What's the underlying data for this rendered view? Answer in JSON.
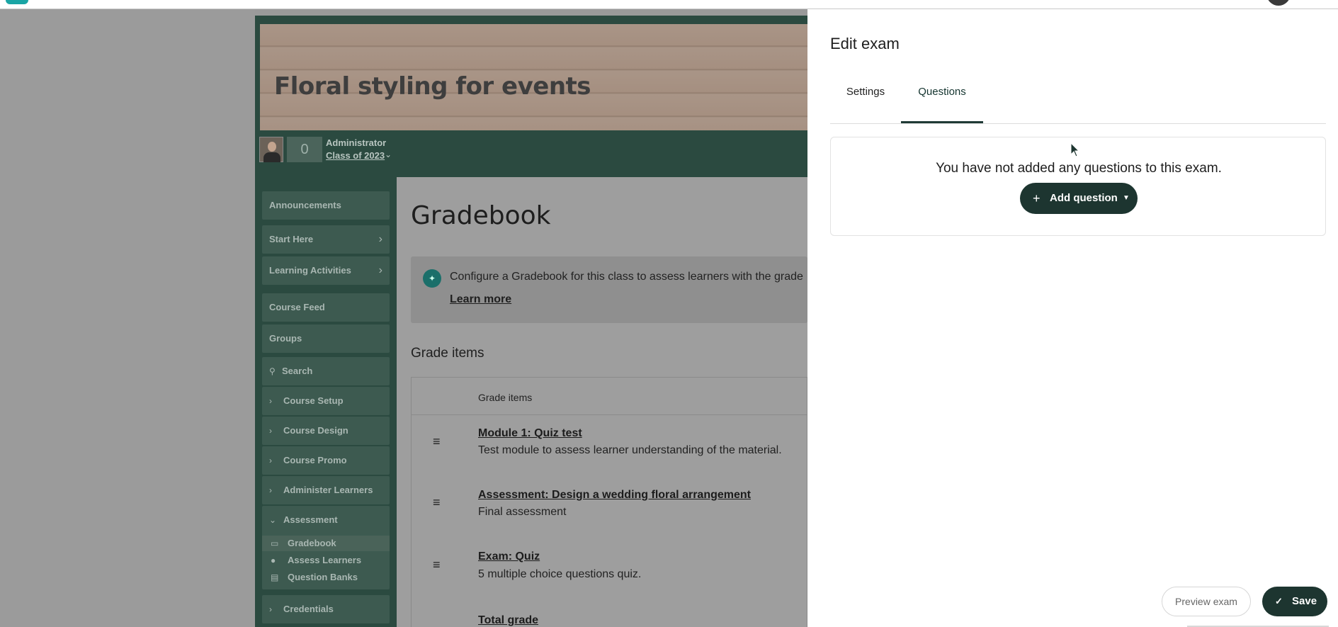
{
  "course": {
    "title": "Floral styling for events",
    "points": "0",
    "role": "Administrator",
    "class_label": "Class of 2023",
    "class_chevron": "⌄"
  },
  "sidebar": {
    "items": [
      {
        "label": "Announcements"
      },
      {
        "label": "Start Here",
        "arrow": "›"
      },
      {
        "label": "Learning Activities",
        "arrow": "›"
      },
      {
        "label": "Course Feed"
      },
      {
        "label": "Groups"
      },
      {
        "label": "Search",
        "icon": "search-icon"
      },
      {
        "label": "Course Setup"
      },
      {
        "label": "Course Design"
      },
      {
        "label": "Course Promo"
      },
      {
        "label": "Administer Learners"
      },
      {
        "label": "Assessment"
      },
      {
        "label": "Credentials"
      }
    ],
    "assessment_sub": [
      {
        "label": "Gradebook",
        "icon": "book-icon"
      },
      {
        "label": "Assess Learners",
        "icon": "people-icon"
      },
      {
        "label": "Question Banks",
        "icon": "bank-icon"
      }
    ]
  },
  "gradebook": {
    "title": "Gradebook",
    "callout_text": "Configure a Gradebook for this class to assess learners with the grade",
    "callout_link": "Learn more",
    "section_heading": "Grade items",
    "table_header": "Grade items",
    "rows": [
      {
        "title": "Module 1: Quiz test",
        "desc": "Test module to assess learner understanding of the material."
      },
      {
        "title": "Assessment: Design a wedding floral arrangement",
        "desc": "Final assessment"
      },
      {
        "title": "Exam: Quiz",
        "desc": "5 multiple choice questions quiz."
      },
      {
        "title": "Total grade",
        "desc": ""
      }
    ]
  },
  "panel": {
    "title": "Edit exam",
    "tabs": [
      {
        "label": "Settings",
        "active": false
      },
      {
        "label": "Questions",
        "active": true
      }
    ],
    "empty_message": "You have not added any questions to this exam.",
    "add_button": "Add question",
    "preview_button": "Preview exam",
    "save_button": "Save"
  },
  "colors": {
    "primary": "#1d3530",
    "course_green": "#2b4a40",
    "overlay_gray": "#9b9b9b"
  }
}
